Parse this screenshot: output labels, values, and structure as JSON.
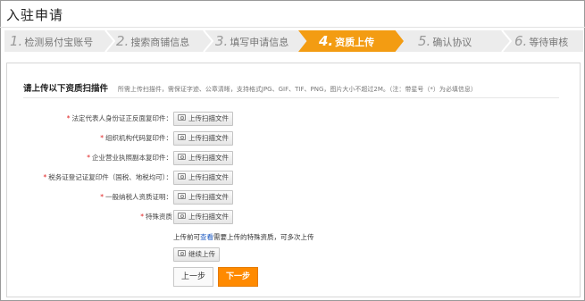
{
  "page": {
    "title": "入驻申请"
  },
  "steps": [
    {
      "num": "1.",
      "label": "检测易付宝账号",
      "active": false
    },
    {
      "num": "2.",
      "label": "搜索商铺信息",
      "active": false
    },
    {
      "num": "3.",
      "label": "填写申请信息",
      "active": false
    },
    {
      "num": "4.",
      "label": "资质上传",
      "active": true
    },
    {
      "num": "5.",
      "label": "确认协议",
      "active": false
    },
    {
      "num": "6.",
      "label": "等待审核",
      "active": false
    }
  ],
  "colors": {
    "accent": "#f39c12",
    "required": "#e02020",
    "link": "#1a57c0",
    "next_button": "#ff8a00"
  },
  "panel": {
    "heading": "请上传以下资质扫描件",
    "note": "所需上传扫描件，需保证字迹、公章清晰，支持格式JPG、GIF、TIF、PNG，图片大小不超过2M。（注：带星号（*）为必填信息）",
    "upload_label": "上传扫描文件",
    "fields": [
      {
        "label": "法定代表人身份证正反面复印件：",
        "required": true
      },
      {
        "label": "组织机构代码复印件：",
        "required": true
      },
      {
        "label": "企业营业执照副本复印件：",
        "required": true
      },
      {
        "label": "税务证登记证复印件（国税、地税均可）：",
        "required": true
      },
      {
        "label": "一般纳税人资质证明：",
        "required": true
      },
      {
        "label": "特殊资质",
        "required": true
      }
    ],
    "tip_before": "上传前可",
    "tip_link": "查看",
    "tip_after": "需要上传的特殊资质，可多次上传",
    "continue_label": "继续上传"
  },
  "nav": {
    "prev_label": "上一步",
    "next_label": "下一步"
  }
}
